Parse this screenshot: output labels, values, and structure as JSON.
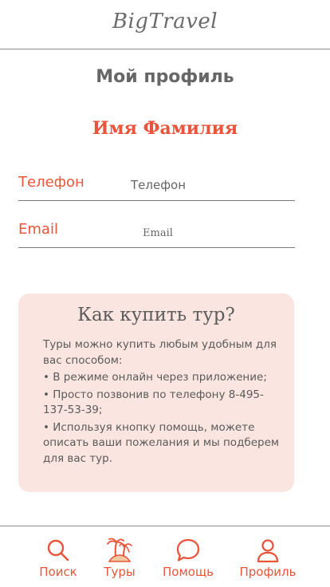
{
  "header": {
    "logo": "BigTravel"
  },
  "page": {
    "title": "Мой профиль",
    "user_name": "Имя Фамилия"
  },
  "form": {
    "phone_label": "Телефон",
    "phone_placeholder": "Телефон",
    "email_label": "Email",
    "email_placeholder": "Email"
  },
  "info_card": {
    "title": "Как купить тур?",
    "intro": "Туры можно купить любым удобным для вас способом:",
    "item1": "•  В режиме онлайн через приложение;",
    "item2": "• Просто позвонив по телефону 8-495-137-53-39;",
    "item3": "• Используя кнопку помощь, можете описать ваши пожелания и мы подберем для вас тур."
  },
  "nav": {
    "search": "Поиск",
    "tours": "Туры",
    "help": "Помощь",
    "profile": "Профиль"
  },
  "colors": {
    "accent": "#e8553a",
    "card_bg": "#fbe5e0",
    "text": "#5a5a5a"
  }
}
